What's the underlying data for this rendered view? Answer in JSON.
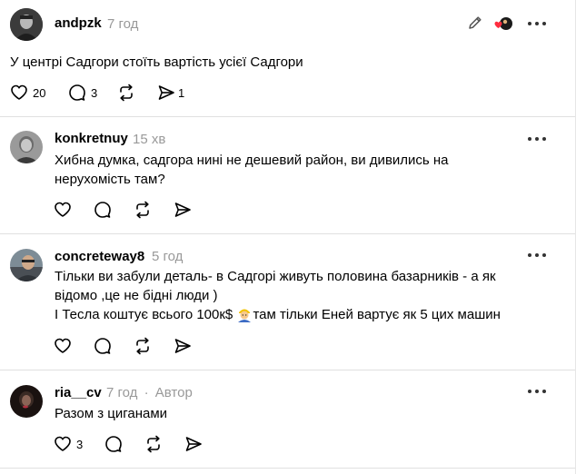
{
  "post": {
    "username": "andpzk",
    "time": "7 год",
    "text": "У центрі Садгори стоїть вартість усієї Садгори",
    "likes": "20",
    "replies": "3",
    "reposts": "",
    "shares": "1"
  },
  "replies": [
    {
      "username": "konkretnuy",
      "time": "15 хв",
      "text": "Хибна думка, садгора нині не дешевий район, ви дивились на нерухомість там?"
    },
    {
      "username": "concreteway8",
      "time": "5 год",
      "line1": "Тільки ви забули деталь- в Садгорі живуть половина базарників - а як",
      "line2": "відомо ,це не бідні люди )",
      "line3a": "І Тесла коштує всього 100к$ ",
      "line3b": "там тільки Еней вартує як 5 цих машин"
    },
    {
      "username": "ria__cv",
      "time": "7 год",
      "separator": "·",
      "author_badge": "Автор",
      "text": "Разом з циганами",
      "likes": "3"
    }
  ]
}
